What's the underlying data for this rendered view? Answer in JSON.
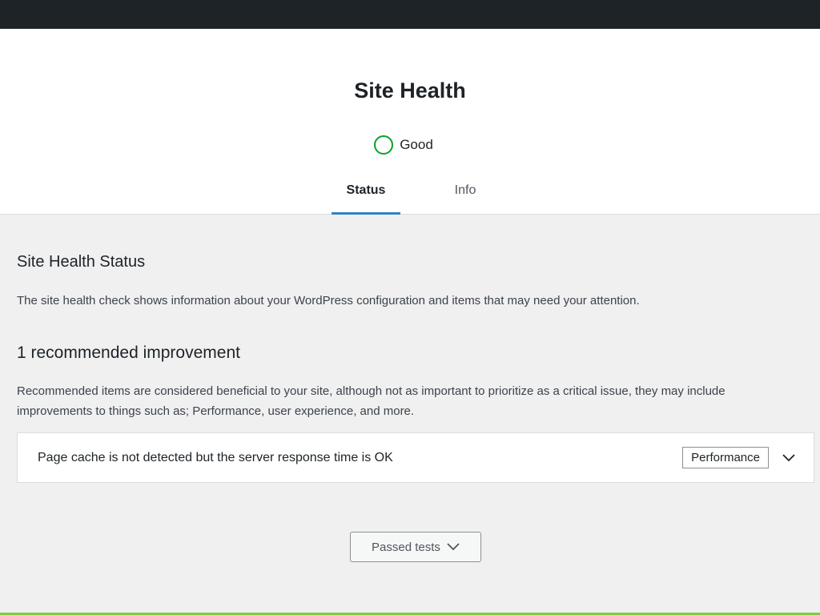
{
  "header": {
    "title": "Site Health",
    "status_label": "Good",
    "status_color": "#00a32a"
  },
  "tabs": [
    {
      "label": "Status",
      "active": true
    },
    {
      "label": "Info",
      "active": false
    }
  ],
  "main": {
    "section_title": "Site Health Status",
    "description": "The site health check shows information about your WordPress configuration and items that may need your attention.",
    "improvement_heading": "1 recommended improvement",
    "recommended_description": "Recommended items are considered beneficial to your site, although not as important to prioritize as a critical issue, they may include improvements to things such as; Performance, user experience, and more.",
    "issues": [
      {
        "text": "Page cache is not detected but the server response time is OK",
        "badge": "Performance",
        "icon": "chevron-down-icon"
      }
    ],
    "passed_tests_label": "Passed tests"
  },
  "colors": {
    "admin_bar": "#1d2327",
    "tab_underline": "#3582c4",
    "background": "#f0f0f1"
  }
}
